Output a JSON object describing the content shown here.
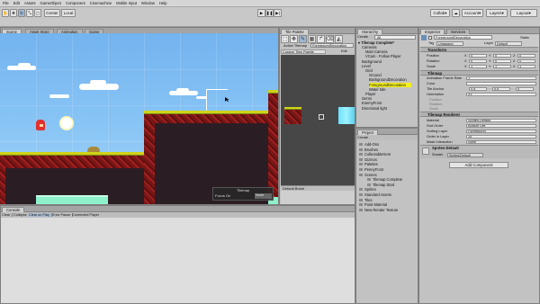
{
  "menu": [
    "File",
    "Edit",
    "Assets",
    "GameObject",
    "Component",
    "Cinemachine",
    "Mobile Input",
    "Window",
    "Help"
  ],
  "toolbar": {
    "pivot": "Center",
    "space": "Local",
    "collab": "Collab",
    "account": "Account",
    "layers": "Layers",
    "layout": "Layout"
  },
  "scene": {
    "tabs": [
      "Scene",
      "Asset Store",
      "Animation",
      "Game"
    ],
    "options": [
      "Shaded",
      "2D"
    ],
    "gizmos": "Gizmos",
    "search": "All",
    "overlay": {
      "title": "Tilemap",
      "focus_label": "Focus On",
      "focus_value": "None"
    }
  },
  "tile_palette": {
    "tab": "Tile Palette",
    "active_tilemap_label": "Active Tilemap",
    "active_tilemap_value": "ForegroundDecoration",
    "palette_name": "Custom Tiles Palette",
    "edit_label": "Edit",
    "default_brush": "Default Brush"
  },
  "hierarchy": {
    "tab": "Hierarchy",
    "create": "Create",
    "search_placeholder": "All",
    "scene_name": "Tilemap Complete*",
    "items": [
      {
        "label": "Cameras",
        "depth": 1,
        "selected": false
      },
      {
        "label": "Main Camera",
        "depth": 2,
        "selected": false
      },
      {
        "label": "VCam - Follow Player",
        "depth": 2,
        "selected": false
      },
      {
        "label": "Background",
        "depth": 1,
        "selected": false
      },
      {
        "label": "Level",
        "depth": 1,
        "selected": false
      },
      {
        "label": "Grid",
        "depth": 2,
        "selected": false
      },
      {
        "label": "Ground",
        "depth": 3,
        "selected": false
      },
      {
        "label": "BackgroundDecoration",
        "depth": 3,
        "selected": false
      },
      {
        "label": "ForegroundDecoration",
        "depth": 3,
        "selected": true
      },
      {
        "label": "Water tide",
        "depth": 3,
        "selected": false
      },
      {
        "label": "Player",
        "depth": 2,
        "selected": false
      },
      {
        "label": "Gems",
        "depth": 1,
        "selected": false
      },
      {
        "label": "EnemyFrost",
        "depth": 1,
        "selected": false
      },
      {
        "label": "Directional light",
        "depth": 1,
        "selected": false
      }
    ]
  },
  "project": {
    "tab": "Project",
    "create": "Create",
    "folders": [
      "Add-Ons",
      "Brushes",
      "CollectableGem",
      "Gizmos",
      "Palettes",
      "PennyFrost",
      "Scenes",
      "Tilemap Complete",
      "Tilemap Start",
      "Sprites",
      "Standard Assets",
      "Tiles",
      "Point Material",
      "New Render Texture"
    ]
  },
  "inspector": {
    "tabs": [
      "Inspector",
      "Services"
    ],
    "object_name": "ForegroundDecoration",
    "static_label": "Static",
    "tag_label": "Tag",
    "tag_value": "Untagged",
    "layer_label": "Layer",
    "layer_value": "Default",
    "transform": {
      "title": "Transform",
      "rows": [
        {
          "label": "Position",
          "x": "0",
          "y": "0",
          "z": "0"
        },
        {
          "label": "Rotation",
          "x": "0",
          "y": "0",
          "z": "0"
        },
        {
          "label": "Scale",
          "x": "1",
          "y": "1",
          "z": "1"
        }
      ]
    },
    "tilemap": {
      "title": "Tilemap",
      "animation_frame_rate_label": "Animation Frame Rate",
      "animation_frame_rate_value": "1",
      "color_label": "Color",
      "tile_anchor_label": "Tile Anchor",
      "tile_anchor": {
        "x": "0.5",
        "y": "0.5",
        "z": "0"
      },
      "orientation_label": "Orientation",
      "orientation_value": "XY",
      "position_label": "Position",
      "rotation_label": "Rotation",
      "scale_label": "Scale"
    },
    "tilemap_renderer": {
      "title": "Tilemap Renderer",
      "rows": [
        {
          "label": "Material",
          "value": "Sprites-Default"
        },
        {
          "label": "Sort Order",
          "value": "Bottom Left"
        },
        {
          "label": "Sorting Layer",
          "value": "Foreground"
        },
        {
          "label": "Order in Layer",
          "value": "10"
        },
        {
          "label": "Mask Interaction",
          "value": "None"
        }
      ]
    },
    "material": {
      "name": "Sprites-Default",
      "shader_label": "Shader",
      "shader_value": "Sprites/Default"
    },
    "add_component": "Add Component"
  },
  "console": {
    "tab": "Console",
    "buttons": [
      "Clear",
      "Collapse",
      "Clear on Play",
      "Error Pause",
      "Connected Player"
    ]
  },
  "colors": {
    "sky": "#7ab8f0",
    "rock": "#8f1c1c",
    "grass": "#cfd21a",
    "water": "#8ff0cc",
    "selection_highlight": "#f4f01c",
    "editor_bg": "#c2c2c2"
  }
}
